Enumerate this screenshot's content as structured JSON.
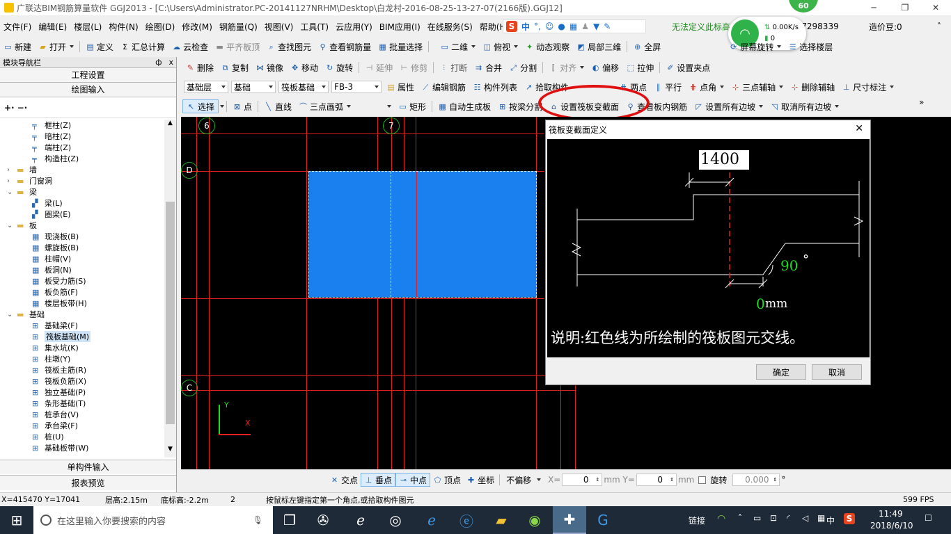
{
  "title_bar": {
    "text": "广联达BIM钢筋算量软件 GGJ2013 - [C:\\Users\\Administrator.PC-20141127NRHM\\Desktop\\白龙村-2016-08-25-13-27-07(2166版).GGJ12]",
    "minimize": "─",
    "maximize": "❐",
    "close": "✕"
  },
  "badge": {
    "value": "60"
  },
  "menu": [
    "文件(F)",
    "编辑(E)",
    "楼层(L)",
    "构件(N)",
    "绘图(D)",
    "修改(M)",
    "钢筋量(Q)",
    "视图(V)",
    "工具(T)",
    "云应用(Y)",
    "BIM应用(I)",
    "在线服务(S)",
    "帮助(H)"
  ],
  "ime": {
    "logo": "S",
    "lang": "中",
    "punct": "°,"
  },
  "menu_right": {
    "notice": "无法定义此标高",
    "phone": "907298339",
    "price": "造价豆:0"
  },
  "net": {
    "speed": "0.00K/s",
    "count": "0"
  },
  "toolbar1": {
    "new": "新建",
    "open": "打开",
    "define": "定义",
    "sum": "汇总计算",
    "cloud": "云检查",
    "flat": "平齐板顶",
    "find": "查找图元",
    "view_rebar": "查看钢筋量",
    "batch": "批量选择",
    "dim": "二维",
    "top": "俯视",
    "dynamic": "动态观察",
    "local3d": "局部三维",
    "full": "全屏",
    "rotate_screen": "屏幕旋转",
    "select_floor": "选择楼层"
  },
  "toolbar2": {
    "delete": "删除",
    "copy": "复制",
    "mirror": "镜像",
    "move": "移动",
    "rotate": "旋转",
    "extend": "延伸",
    "trim": "修剪",
    "break": "打断",
    "merge": "合并",
    "split": "分割",
    "align": "对齐",
    "offset": "偏移",
    "stretch": "拉伸",
    "grip": "设置夹点"
  },
  "toolbar3": {
    "layer": "基础层",
    "floor": "基础",
    "type": "筏板基础",
    "component": "FB-3",
    "props": "属性",
    "edit_rebar": "编辑钢筋",
    "list": "构件列表",
    "pick": "拾取构件",
    "two_pt": "两点",
    "parallel": "平行",
    "point_angle": "点角",
    "three_axis": "三点辅轴",
    "del_axis": "删除辅轴",
    "dimension": "尺寸标注"
  },
  "toolbar4": {
    "select": "选择",
    "point": "点",
    "line": "直线",
    "arc": "三点画弧",
    "rect": "矩形",
    "auto": "自动生成板",
    "by_beam": "按梁分割",
    "set_section": "设置筏板变截面",
    "view_inner": "查看板内钢筋",
    "set_all_slope": "设置所有边坡",
    "cancel_all_slope": "取消所有边坡"
  },
  "sidebar": {
    "title": "模块导航栏",
    "pin": "ф",
    "close": "x",
    "project": "工程设置",
    "drawing": "绘图输入",
    "single": "单构件输入",
    "report": "报表预览",
    "tree": [
      {
        "label": "框柱(Z)",
        "level": 2,
        "icon": "column"
      },
      {
        "label": "暗柱(Z)",
        "level": 2,
        "icon": "column"
      },
      {
        "label": "端柱(Z)",
        "level": 2,
        "icon": "column"
      },
      {
        "label": "构造柱(Z)",
        "level": 2,
        "icon": "column"
      },
      {
        "label": "墙",
        "level": 1,
        "icon": "folder",
        "expander": "›"
      },
      {
        "label": "门窗洞",
        "level": 1,
        "icon": "folder",
        "expander": "›"
      },
      {
        "label": "梁",
        "level": 1,
        "icon": "folder",
        "expander": "⌄"
      },
      {
        "label": "梁(L)",
        "level": 2,
        "icon": "beam"
      },
      {
        "label": "圈梁(E)",
        "level": 2,
        "icon": "beam"
      },
      {
        "label": "板",
        "level": 1,
        "icon": "folder",
        "expander": "⌄"
      },
      {
        "label": "现浇板(B)",
        "level": 2,
        "icon": "slab"
      },
      {
        "label": "螺旋板(B)",
        "level": 2,
        "icon": "slab"
      },
      {
        "label": "柱帽(V)",
        "level": 2,
        "icon": "slab"
      },
      {
        "label": "板洞(N)",
        "level": 2,
        "icon": "slab"
      },
      {
        "label": "板受力筋(S)",
        "level": 2,
        "icon": "slab"
      },
      {
        "label": "板负筋(F)",
        "level": 2,
        "icon": "slab"
      },
      {
        "label": "楼层板带(H)",
        "level": 2,
        "icon": "slab"
      },
      {
        "label": "基础",
        "level": 1,
        "icon": "folder",
        "expander": "⌄"
      },
      {
        "label": "基础梁(F)",
        "level": 2,
        "icon": "found"
      },
      {
        "label": "筏板基础(M)",
        "level": 2,
        "icon": "found",
        "selected": true
      },
      {
        "label": "集水坑(K)",
        "level": 2,
        "icon": "found"
      },
      {
        "label": "柱墩(Y)",
        "level": 2,
        "icon": "found"
      },
      {
        "label": "筏板主筋(R)",
        "level": 2,
        "icon": "found"
      },
      {
        "label": "筏板负筋(X)",
        "level": 2,
        "icon": "found"
      },
      {
        "label": "独立基础(P)",
        "level": 2,
        "icon": "found"
      },
      {
        "label": "条形基础(T)",
        "level": 2,
        "icon": "found"
      },
      {
        "label": "桩承台(V)",
        "level": 2,
        "icon": "found"
      },
      {
        "label": "承台梁(F)",
        "level": 2,
        "icon": "found"
      },
      {
        "label": "桩(U)",
        "level": 2,
        "icon": "found"
      },
      {
        "label": "基础板带(W)",
        "level": 2,
        "icon": "found"
      }
    ]
  },
  "canvas": {
    "axes": [
      "6",
      "7",
      "D",
      "C"
    ],
    "ucs": {
      "y": "Y",
      "x": "X"
    }
  },
  "dialog": {
    "title": "筏板变截面定义",
    "width_value": "1400",
    "angle_value": "90",
    "degree": "°",
    "height_value": "0",
    "unit": "mm",
    "note": "说明:红色线为所绘制的筏板图元交线。",
    "ok": "确定",
    "cancel": "取消"
  },
  "snapbar": {
    "intersect": "交点",
    "perp": "垂点",
    "mid": "中点",
    "vertex": "顶点",
    "coord": "坐标",
    "offset_mode": "不偏移",
    "x_label": "X=",
    "x_val": "0",
    "y_label": "mm Y=",
    "y_val": "0",
    "mm": "mm",
    "rotate": "旋转",
    "rot_val": "0.000",
    "deg": "°"
  },
  "statusbar": {
    "coords": "X=415470 Y=17041",
    "floor_height": "层高:2.15m",
    "bottom": "底标高:-2.2m",
    "num": "2",
    "hint": "按鼠标左键指定第一个角点,或拾取构件图元",
    "fps": "599 FPS"
  },
  "taskbar": {
    "search": "在这里输入你要搜索的内容",
    "link": "链接",
    "ime": "中",
    "time": "11:49",
    "date": "2018/6/10"
  }
}
